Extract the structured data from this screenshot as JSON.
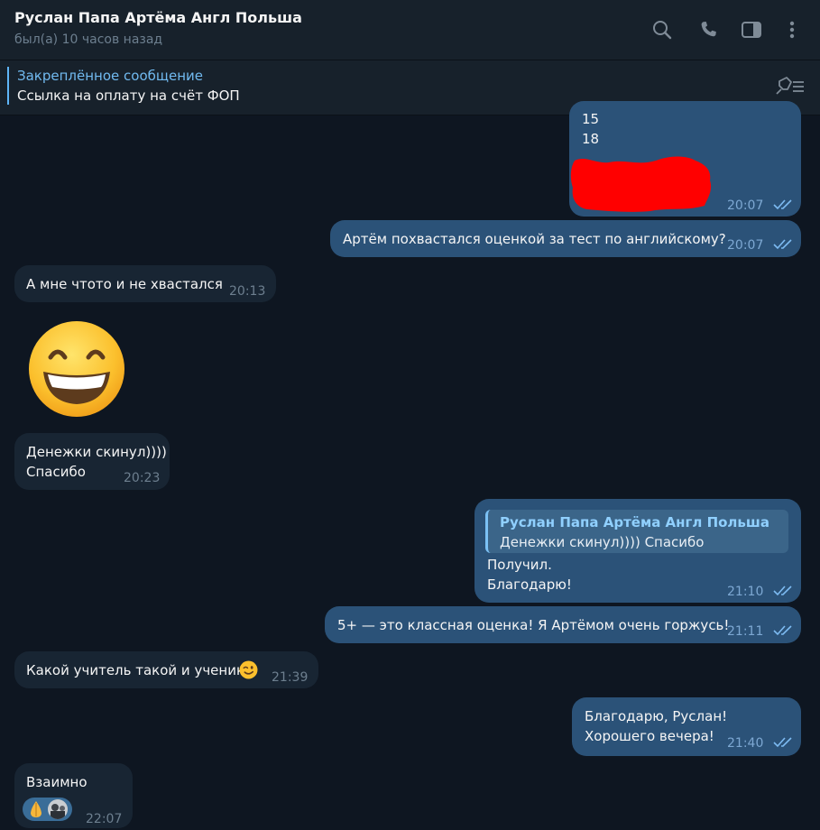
{
  "header": {
    "title": "Руслан Папа Артёма Англ Польша",
    "status": "был(а) 10 часов назад",
    "icons": [
      "search-icon",
      "phone-icon",
      "sidebar-toggle-icon",
      "more-vertical-icon"
    ]
  },
  "pinned": {
    "title": "Закреплённое сообщение",
    "text": "Ссылка на оплату на счёт ФОП",
    "icon": "unpin-list-icon"
  },
  "colors": {
    "background": "#0e1621",
    "outgoing_bubble": "#2b5278",
    "incoming_bubble": "#182533",
    "accent": "#5eb5f7",
    "redaction": "#ff0000"
  },
  "messages": [
    {
      "direction": "out",
      "lines": [
        "15",
        "18"
      ],
      "redacted": true,
      "time": "20:07",
      "status": "read"
    },
    {
      "direction": "out",
      "lines": [
        "Артём похвастался оценкой за тест по английскому?"
      ],
      "time": "20:07",
      "status": "read"
    },
    {
      "direction": "in",
      "lines": [
        "А мне чтото и не хвастался"
      ],
      "time": "20:13"
    },
    {
      "direction": "in",
      "type": "emoji",
      "emoji": "grinning-face-smiling-eyes"
    },
    {
      "direction": "in",
      "lines": [
        "Денежки скинул))))",
        "Спасибо"
      ],
      "time": "20:23"
    },
    {
      "direction": "out",
      "reply": {
        "author": "Руслан Папа Артёма Англ Польша",
        "text": "Денежки скинул)))) Спасибо"
      },
      "lines": [
        "Получил.",
        "Благодарю!"
      ],
      "time": "21:10",
      "status": "read"
    },
    {
      "direction": "out",
      "lines": [
        "5+ — это классная оценка! Я Артёмом очень горжусь!"
      ],
      "time": "21:11",
      "status": "read"
    },
    {
      "direction": "in",
      "lines": [
        "Какой учитель такой и ученик"
      ],
      "emoji": "winking-face",
      "time": "21:39"
    },
    {
      "direction": "out",
      "lines": [
        "Благодарю, Руслан!",
        "Хорошего вечера!"
      ],
      "time": "21:40",
      "status": "read"
    },
    {
      "direction": "in",
      "lines": [
        "Взаимно"
      ],
      "reaction": "folded-hands",
      "time": "22:07"
    }
  ]
}
